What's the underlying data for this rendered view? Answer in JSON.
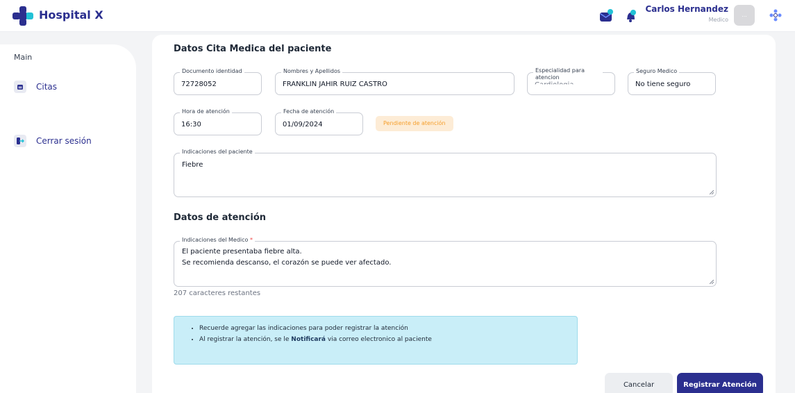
{
  "app": {
    "name": "Hospital X"
  },
  "user": {
    "name": "Carlos Hernandez",
    "role": "Medico",
    "avatar_text": "..."
  },
  "sidebar": {
    "section": "Main",
    "items": [
      {
        "label": "Citas",
        "icon": "calendar-icon"
      },
      {
        "label": "Cerrar sesión",
        "icon": "logout-icon"
      }
    ]
  },
  "appointment": {
    "title": "Datos Cita Medica del paciente",
    "fields": {
      "document": {
        "label": "Documento identidad",
        "value": "72728052"
      },
      "names": {
        "label": "Nombres y Apellidos",
        "value": "FRANKLIN JAHIR RUIZ CASTRO"
      },
      "specialty": {
        "label": "Especialidad para atencion",
        "value": "Cardiologia"
      },
      "insurance": {
        "label": "Seguro Medico",
        "value": "No tiene seguro"
      },
      "time": {
        "label": "Hora de atención",
        "value": "16:30"
      },
      "date": {
        "label": "Fecha de atención",
        "value": "01/09/2024"
      }
    },
    "status_badge": "Pendiente de atención",
    "patient_notes": {
      "label": "Indicaciones del paciente",
      "value": "Fiebre"
    }
  },
  "attention": {
    "title": "Datos de atención",
    "doctor_notes": {
      "label": "Indicaciones del Medico",
      "required_mark": "*",
      "lines": [
        "El paciente presentaba fiebre alta.",
        "Se recomienda descanso, el corazón se puede ver afectado."
      ]
    },
    "remaining": "207 caracteres restantes"
  },
  "info": {
    "item1": "Recuerde agregar las indicaciones para poder registrar la atención",
    "item2_pre": "Al registrar la atención, se le ",
    "item2_bold": "Notificará",
    "item2_post": " via correo electronico al paciente"
  },
  "actions": {
    "cancel": "Cancelar",
    "submit": "Registrar Atención"
  },
  "colors": {
    "primary": "#2b2f8f",
    "badge_bg": "#fdecd6",
    "badge_text": "#f59e2b",
    "info_bg": "#c9eef8"
  }
}
